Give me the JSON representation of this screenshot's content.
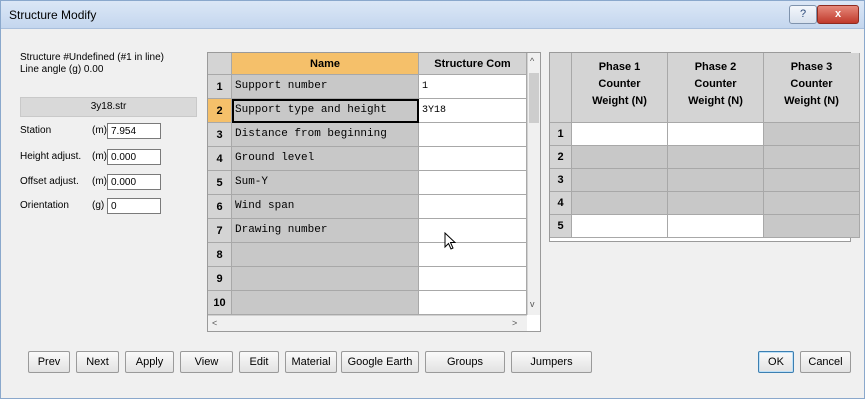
{
  "window": {
    "title": "Structure Modify",
    "help_label": "?",
    "close_label": "x"
  },
  "info": {
    "line1": "Structure #Undefined (#1 in line)",
    "line2": "Line angle (g) 0.00"
  },
  "file_name": "3y18.str",
  "fields": [
    {
      "label": "Station",
      "unit": "(m)",
      "value": "7.954"
    },
    {
      "label": "Height adjust.",
      "unit": "(m)",
      "value": "0.000"
    },
    {
      "label": "Offset adjust.",
      "unit": "(m)",
      "value": "0.000"
    },
    {
      "label": "Orientation",
      "unit": "(g)",
      "value": "0"
    }
  ],
  "param_grid": {
    "col_name": "Name",
    "col_value": "Structure Com",
    "rows": [
      {
        "num": "1",
        "name": "Support  number",
        "value": "1"
      },
      {
        "num": "2",
        "name": "Support type and height",
        "value": "3Y18"
      },
      {
        "num": "3",
        "name": "Distance from beginning",
        "value": ""
      },
      {
        "num": "4",
        "name": "Ground level",
        "value": ""
      },
      {
        "num": "5",
        "name": "Sum-Y",
        "value": ""
      },
      {
        "num": "6",
        "name": "Wind span",
        "value": ""
      },
      {
        "num": "7",
        "name": "Drawing number",
        "value": ""
      },
      {
        "num": "8",
        "name": "",
        "value": ""
      },
      {
        "num": "9",
        "name": "",
        "value": ""
      },
      {
        "num": "10",
        "name": "",
        "value": ""
      }
    ]
  },
  "phase_grid": {
    "headers": [
      {
        "l1": "Phase 1",
        "l2": "Counter",
        "l3": "Weight (N)"
      },
      {
        "l1": "Phase 2",
        "l2": "Counter",
        "l3": "Weight (N)"
      },
      {
        "l1": "Phase 3",
        "l2": "Counter",
        "l3": "Weight (N)"
      }
    ],
    "rows": [
      "1",
      "2",
      "3",
      "4",
      "5"
    ]
  },
  "buttons": {
    "prev": "Prev",
    "next": "Next",
    "apply": "Apply",
    "view": "View",
    "edit": "Edit",
    "material": "Material",
    "google_earth": "Google Earth",
    "groups": "Groups",
    "jumpers": "Jumpers",
    "ok": "OK",
    "cancel": "Cancel"
  }
}
